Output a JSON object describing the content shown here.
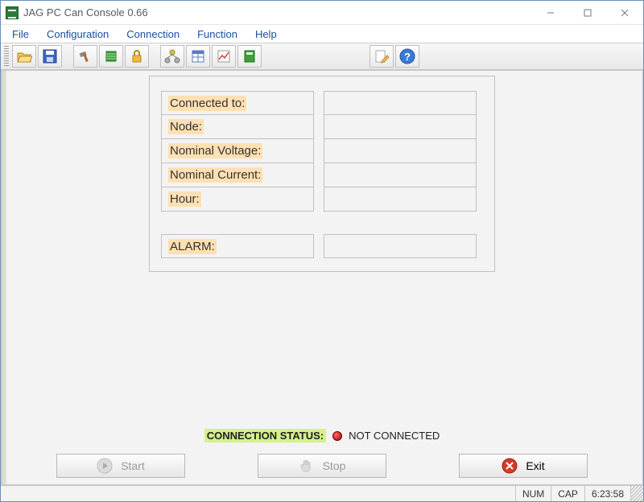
{
  "window": {
    "title": "JAG PC Can Console 0.66"
  },
  "menu": {
    "file": "File",
    "configuration": "Configuration",
    "connection": "Connection",
    "function": "Function",
    "help": "Help"
  },
  "toolbar_icons": {
    "open": "open-folder-icon",
    "save": "save-icon",
    "hammer": "hammer-icon",
    "chip": "chip-icon",
    "lock": "lock-icon",
    "nodes": "nodes-icon",
    "table": "table-icon",
    "chart": "chart-icon",
    "book": "book-icon",
    "edit": "edit-icon",
    "help": "help-icon"
  },
  "fields": {
    "connected_to": {
      "label": "Connected to:",
      "value": ""
    },
    "node": {
      "label": "Node:",
      "value": ""
    },
    "nominal_voltage": {
      "label": "Nominal Voltage:",
      "value": ""
    },
    "nominal_current": {
      "label": "Nominal Current:",
      "value": ""
    },
    "hour": {
      "label": "Hour:",
      "value": ""
    },
    "alarm": {
      "label": "ALARM:",
      "value": ""
    }
  },
  "connection": {
    "label": "CONNECTION STATUS:",
    "text": "NOT CONNECTED",
    "color": "#a00000"
  },
  "buttons": {
    "start": "Start",
    "stop": "Stop",
    "exit": "Exit"
  },
  "statusbar": {
    "num": "NUM",
    "cap": "CAP",
    "time": "6:23:58"
  }
}
